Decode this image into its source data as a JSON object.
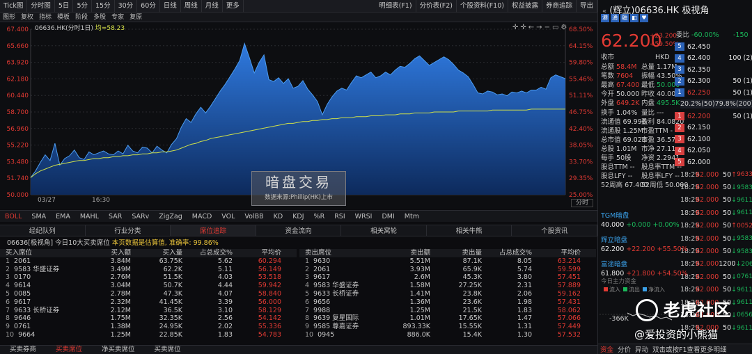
{
  "top_toolbar": {
    "items": [
      "Tick图",
      "分时图",
      "5日",
      "5分",
      "15分",
      "30分",
      "60分",
      "日线",
      "周线",
      "月线",
      "更多"
    ],
    "right_items": [
      "明细表(F1)",
      "分价表(F2)",
      "个股资料(F10)",
      "权益披露",
      "券商追踪",
      "导出"
    ]
  },
  "sub_toolbar": {
    "items": [
      "图形",
      "复权",
      "指标",
      "模板",
      "阶段",
      "多股",
      "专家",
      "复原"
    ]
  },
  "chart_legend": {
    "symbol": "06636.HK(分时1日)",
    "avg_label": "均=58.23"
  },
  "watermark": {
    "title": "暗盘交易",
    "source": "数据来源:Phillip(HK)上市"
  },
  "fenshi_btn": "分时",
  "chart_data": {
    "type": "area",
    "title": "06636.HK(分时1日)",
    "x_start": "03/27",
    "x_mid": "16:30",
    "ylim": [
      50.0,
      67.4
    ],
    "y_ticks": [
      "67.400",
      "65.660",
      "63.920",
      "62.180",
      "60.440",
      "58.700",
      "56.960",
      "55.220",
      "53.480",
      "51.740",
      "50.000"
    ],
    "pct_ticks": [
      "68.50%",
      "64.15%",
      "59.80%",
      "55.46%",
      "51.11%",
      "46.75%",
      "42.40%",
      "38.05%",
      "33.70%",
      "29.35%",
      "25.00%"
    ],
    "price": [
      51.8,
      52.5,
      53.4,
      54.2,
      53.6,
      55.4,
      53.1,
      53.8,
      54.1,
      54.7,
      53.9,
      53.7,
      54.5,
      54.2,
      54.4,
      54.6,
      54.3,
      54.2,
      54.6,
      54.3,
      55.2,
      54.6,
      54.4,
      55.0,
      54.9,
      54.4,
      55.1,
      54.7,
      54.4,
      55.3,
      55.9,
      57.1,
      58.0,
      57.6,
      58.5,
      59.2,
      58.6,
      59.3,
      60.1,
      60.9,
      61.6,
      62.4,
      63.2,
      64.1,
      65.9,
      64.4,
      62.8,
      63.9,
      64.7,
      62.1,
      61.9,
      62.3,
      61.7,
      62.2,
      61.2,
      61.4,
      62.0,
      61.1,
      60.5,
      59.8,
      58.4,
      59.5,
      60.3,
      60.9,
      61.2,
      61.0,
      61.8,
      62.5,
      62.3,
      62.6,
      62.9,
      62.3,
      62.5,
      62.9,
      62.6,
      63.1,
      63.5,
      63.4,
      63.8,
      64.3,
      64.6,
      64.1,
      63.6,
      63.9,
      64.2,
      64.5,
      64.2,
      63.7,
      63.1,
      62.8,
      62.4,
      61.6,
      60.7,
      60.6,
      60.9,
      60.8,
      60.5,
      60.6,
      60.4,
      60.8,
      60.7,
      60.9,
      60.7,
      61.0,
      61.0,
      61.3,
      61.1,
      62.3,
      62.6,
      62.4,
      62.2
    ],
    "avg": [
      51.8,
      52.2,
      52.5,
      52.7,
      52.9,
      53.1,
      53.2,
      53.3,
      53.4,
      53.5,
      53.6,
      53.6,
      53.7,
      53.8,
      53.8,
      53.9,
      53.9,
      54.0,
      54.0,
      54.1,
      54.1,
      54.2,
      54.2,
      54.3,
      54.3,
      54.4,
      54.4,
      54.5,
      54.5,
      54.6,
      54.7,
      54.9,
      55.1,
      55.3,
      55.4,
      55.6,
      55.7,
      55.9,
      56.0,
      56.1,
      56.2,
      56.3,
      56.4,
      56.5,
      56.6,
      56.7,
      56.8,
      56.9,
      57.0,
      57.1,
      57.2,
      57.3,
      57.4,
      57.5,
      57.5,
      57.6,
      57.7,
      57.7,
      57.8,
      57.8,
      57.9,
      57.9,
      58.0,
      58.0,
      58.1,
      58.1,
      58.1,
      58.2,
      58.2,
      58.2,
      58.3,
      58.3,
      58.3,
      58.4,
      58.4,
      58.4,
      58.5,
      58.5,
      58.5,
      58.6,
      58.6,
      58.6,
      58.6,
      58.7,
      58.7,
      58.7,
      58.7,
      58.7,
      58.8,
      58.8,
      58.8,
      58.8,
      58.8,
      58.8,
      58.8,
      58.9,
      58.9,
      58.9,
      58.9,
      58.9,
      58.9,
      58.9,
      58.9,
      59.0,
      59.0,
      59.0,
      59.0,
      59.0,
      59.0,
      59.0,
      59.0
    ],
    "series": [
      {
        "name": "",
        "color": "#2a72d6"
      },
      {
        "name": "均",
        "color": "#cfe04a"
      }
    ]
  },
  "indicator_tabs": [
    "BOLL",
    "SMA",
    "EMA",
    "MAHL",
    "SAR",
    "SARv",
    "ZigZag",
    "MACD",
    "VOL",
    "VolBB",
    "KD",
    "KDJ",
    "%R",
    "RSI",
    "WRSI",
    "DMI",
    "Mtm"
  ],
  "section_tabs": [
    "经纪队列",
    "行业分类",
    "席位追踪",
    "资金流向",
    "相关窝轮",
    "相关牛熊",
    "个股资讯"
  ],
  "info": {
    "prefix": "06636[极视角]  今日10大买卖席位",
    "estimate": "本页数据是估算值,",
    "acc_label": "准确率:",
    "acc_value": "99.86%"
  },
  "buy_table": {
    "headers": [
      "买入席位",
      "买入额",
      "买入量",
      "占总成交%",
      "平均价"
    ],
    "rows": [
      [
        "1",
        "2061",
        "3.84M",
        "63.75K",
        "5.62",
        "60.294"
      ],
      [
        "2",
        "9583 华盛证券",
        "3.49M",
        "62.2K",
        "5.11",
        "56.149"
      ],
      [
        "3",
        "0170",
        "2.76M",
        "51.5K",
        "4.03",
        "53.518"
      ],
      [
        "4",
        "9614",
        "3.04M",
        "50.7K",
        "4.44",
        "59.942"
      ],
      [
        "5",
        "0085",
        "2.78M",
        "47.3K",
        "4.07",
        "58.840"
      ],
      [
        "6",
        "9617",
        "2.32M",
        "41.45K",
        "3.39",
        "56.000"
      ],
      [
        "7",
        "9633 长桥证券",
        "2.12M",
        "36.5K",
        "3.10",
        "58.129"
      ],
      [
        "8",
        "9646",
        "1.75M",
        "32.35K",
        "2.56",
        "54.142"
      ],
      [
        "9",
        "0761",
        "1.38M",
        "24.95K",
        "2.02",
        "55.336"
      ],
      [
        "10",
        "9664",
        "1.25M",
        "22.85K",
        "1.83",
        "54.783"
      ]
    ]
  },
  "sell_table": {
    "headers": [
      "卖出席位",
      "卖出额",
      "卖出量",
      "占总成交%",
      "平均价"
    ],
    "rows": [
      [
        "1",
        "9630",
        "5.51M",
        "87.1K",
        "8.05",
        "63.214"
      ],
      [
        "2",
        "2061",
        "3.93M",
        "65.9K",
        "5.74",
        "59.599"
      ],
      [
        "3",
        "9617",
        "2.6M",
        "45.3K",
        "3.80",
        "57.451"
      ],
      [
        "4",
        "9583 华盛证券",
        "1.58M",
        "27.25K",
        "2.31",
        "57.889"
      ],
      [
        "5",
        "9633 长桥证券",
        "1.41M",
        "23.8K",
        "2.06",
        "59.162"
      ],
      [
        "6",
        "9656",
        "1.36M",
        "23.6K",
        "1.98",
        "57.431"
      ],
      [
        "7",
        "9988",
        "1.25M",
        "21.5K",
        "1.83",
        "58.062"
      ],
      [
        "8",
        "9639 复星国际",
        "1.01M",
        "17.65K",
        "1.47",
        "57.066"
      ],
      [
        "9",
        "9585 尊嘉证券",
        "893.33K",
        "15.55K",
        "1.31",
        "57.449"
      ],
      [
        "10",
        "0945",
        "886.0K",
        "15.4K",
        "1.30",
        "57.532"
      ]
    ]
  },
  "bottom_tabs": [
    "买卖券商",
    "买卖席位",
    "净买卖席位",
    "买卖席位"
  ],
  "quote": {
    "title": "(辉立)06636.HK",
    "name": "极视角",
    "price": "62.200",
    "chg1": "+23.200",
    "chg2": "+59.50%",
    "currency": "HKD",
    "close_label": "收市",
    "stats": [
      [
        "总额",
        "58.4M",
        "总量",
        "1.17M"
      ],
      [
        "笔数",
        "7604",
        "振幅",
        "43.50%"
      ],
      [
        "最高",
        "67.400",
        "最低",
        "50.000"
      ],
      [
        "今开",
        "50.000",
        "昨收",
        "40.000"
      ],
      [
        "外盘",
        "649.2K",
        "内盘",
        "495.5K"
      ],
      [
        "换手",
        "1.04%",
        "量比",
        "---"
      ],
      [
        "流通值",
        "69.99B",
        "盈利",
        "84.0820"
      ],
      [
        "流通股",
        "1.25M",
        "市盈TTM",
        "-"
      ],
      [
        "总市值",
        "69.02B",
        "市盈",
        "36.57"
      ],
      [
        "总股",
        "1.01M",
        "市净",
        "27.11"
      ],
      [
        "每手",
        "50股",
        "净资",
        "2.2941"
      ],
      [
        "股息TTM",
        "--",
        "股息率TTM",
        "--"
      ],
      [
        "股息LFY",
        "--",
        "股息率LFY",
        "--"
      ],
      [
        "52周高",
        "67.400",
        "52周低",
        "50.000"
      ]
    ],
    "weibi": "委比",
    "weibi_val": "-60.00%",
    "weicha": "-150",
    "asks": [
      [
        "5",
        "62.450",
        ""
      ],
      [
        "4",
        "62.400",
        "100 (2)"
      ],
      [
        "3",
        "62.350",
        ""
      ],
      [
        "2",
        "62.300",
        "50 (1)"
      ],
      [
        "1",
        "62.250",
        "50 (1)"
      ]
    ],
    "bids": [
      [
        "1",
        "62.200",
        "50 (1)"
      ],
      [
        "2",
        "62.150",
        ""
      ],
      [
        "3",
        "62.100",
        ""
      ],
      [
        "4",
        "62.050",
        ""
      ],
      [
        "5",
        "62.000",
        ""
      ]
    ],
    "ratio": "20.2%(50)79.8%(200)"
  },
  "ticks": [
    [
      "18:29",
      "62.000",
      "50",
      "↑",
      "9633"
    ],
    [
      "18:29",
      "62.000",
      "50",
      "↓",
      "9583"
    ],
    [
      "18:29",
      "62.000",
      "50",
      "↓",
      "9611"
    ],
    [
      "18:29",
      "62.000",
      "50",
      "↓",
      "9611"
    ],
    [
      "18:29",
      "62.000",
      "50",
      "↑",
      "0052"
    ],
    [
      "18:29",
      "62.000",
      "50",
      "↓",
      "9583"
    ],
    [
      "18:29",
      "62.000",
      "50",
      "↓",
      "9583"
    ],
    [
      "18:29",
      "62.000",
      "1200",
      "↓",
      "2061"
    ],
    [
      "18:29",
      "62.000",
      "50",
      "↓",
      "0761"
    ],
    [
      "18:29",
      "62.000",
      "50",
      "↓",
      "9611"
    ],
    [
      "18:29",
      "62.000",
      "50",
      "↓",
      "9611"
    ],
    [
      "18:29",
      "62.000",
      "50",
      "↓",
      "0656"
    ],
    [
      "18:29",
      "62.000",
      "50",
      "↓",
      "9611"
    ]
  ],
  "blocks": [
    {
      "label": "TGM暗盘",
      "val": "40.000",
      "chg": "+0.000",
      "pct": "+0.00%"
    },
    {
      "label": "辉立暗盘",
      "val": "62.200",
      "chg": "+22.200",
      "pct": "+55.50%"
    },
    {
      "label": "富途暗盘",
      "val": "61.800",
      "chg": "+21.800",
      "pct": "+54.50%"
    }
  ],
  "today_flow": "今日主力资金",
  "mini_legend": [
    "流入",
    "流出",
    "净流入"
  ],
  "mini_val": "-366K",
  "overlay": {
    "logo": "老虎社区",
    "sign": "@爱投资的小熊猫"
  },
  "side_bottom": {
    "items": [
      "资金",
      "分价",
      "异动",
      "双击或按F1查看更多明细"
    ]
  }
}
